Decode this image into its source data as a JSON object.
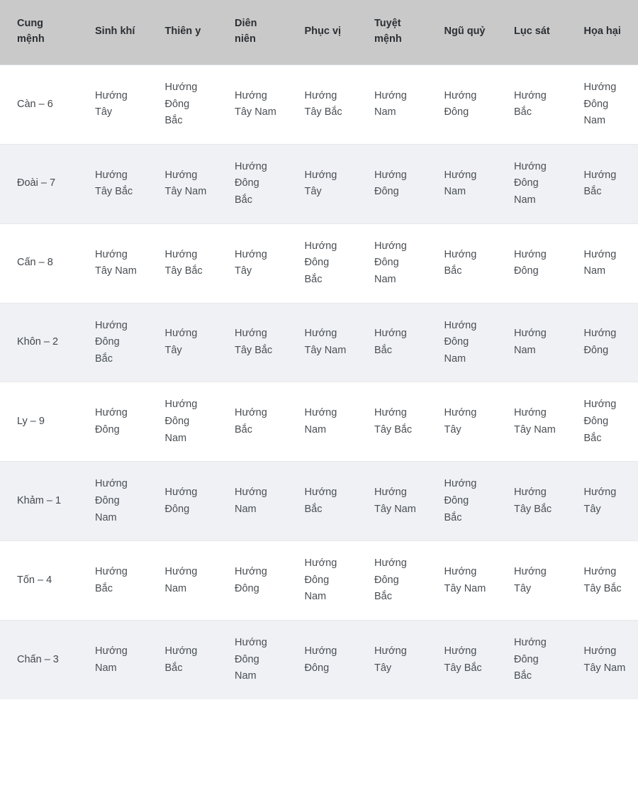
{
  "table": {
    "name": "bang-huong-cung-menh",
    "columns": [
      "Cung mệnh",
      "Sinh khí",
      "Thiên y",
      "Diên niên",
      "Phục vị",
      "Tuyệt mệnh",
      "Ngũ quỷ",
      "Lục sát",
      "Họa hại"
    ],
    "rows": [
      [
        "Càn – 6",
        "Hướng Tây",
        "Hướng Đông Bắc",
        "Hướng Tây Nam",
        "Hướng Tây Bắc",
        "Hướng Nam",
        "Hướng Đông",
        "Hướng Bắc",
        "Hướng Đông Nam"
      ],
      [
        "Đoài – 7",
        "Hướng Tây Bắc",
        "Hướng Tây Nam",
        "Hướng Đông Bắc",
        "Hướng Tây",
        "Hướng Đông",
        "Hướng Nam",
        "Hướng Đông Nam",
        "Hướng Bắc"
      ],
      [
        "Cấn – 8",
        "Hướng Tây Nam",
        "Hướng Tây Bắc",
        "Hướng Tây",
        "Hướng Đông Bắc",
        "Hướng Đông Nam",
        "Hướng Bắc",
        "Hướng Đông",
        "Hướng Nam"
      ],
      [
        "Khôn – 2",
        "Hướng Đông Bắc",
        "Hướng Tây",
        "Hướng Tây Bắc",
        "Hướng Tây Nam",
        "Hướng Bắc",
        "Hướng Đông Nam",
        "Hướng Nam",
        "Hướng Đông"
      ],
      [
        "Ly – 9",
        "Hướng Đông",
        "Hướng Đông Nam",
        "Hướng Bắc",
        "Hướng Nam",
        "Hướng Tây Bắc",
        "Hướng Tây",
        "Hướng Tây Nam",
        "Hướng Đông Bắc"
      ],
      [
        "Khảm – 1",
        "Hướng Đông Nam",
        "Hướng Đông",
        "Hướng Nam",
        "Hướng Bắc",
        "Hướng Tây Nam",
        "Hướng Đông Bắc",
        "Hướng Tây Bắc",
        "Hướng Tây"
      ],
      [
        "Tốn – 4",
        "Hướng Bắc",
        "Hướng Nam",
        "Hướng Đông",
        "Hướng Đông Nam",
        "Hướng Đông Bắc",
        "Hướng Tây Nam",
        "Hướng Tây",
        "Hướng Tây Bắc"
      ],
      [
        "Chấn – 3",
        "Hướng Nam",
        "Hướng Bắc",
        "Hướng Đông Nam",
        "Hướng Đông",
        "Hướng Tây",
        "Hướng Tây Bắc",
        "Hướng Đông Bắc",
        "Hướng Tây Nam"
      ]
    ]
  },
  "colors": {
    "header_bg": "#c9c9c9",
    "row_bg": "#ffffff",
    "row_alt_bg": "#eff1f4",
    "header_text": "#2b2f33",
    "body_text": "#4a4f54",
    "border": "#e6e8eb"
  }
}
